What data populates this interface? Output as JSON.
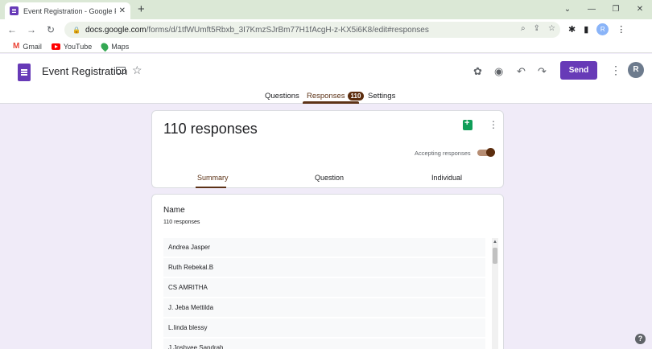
{
  "browser": {
    "tab_title": "Event Registration - Google Form",
    "tab_close": "✕",
    "new_tab": "+",
    "url_host": "docs.google.com",
    "url_path": "/forms/d/1tfWUmft5Rbxb_3I7KmzSJrBm77H1fAcgH-z-KX5i6K8/edit#responses",
    "profile_initial": "R",
    "bookmarks": [
      "Gmail",
      "YouTube",
      "Maps"
    ],
    "window_controls": [
      "⌄",
      "—",
      "❐",
      "✕"
    ]
  },
  "form": {
    "title": "Event Registration",
    "send_label": "Send",
    "avatar_initial": "R",
    "tabs": {
      "questions": "Questions",
      "responses": "Responses",
      "responses_count": "110",
      "settings": "Settings"
    }
  },
  "summary": {
    "heading": "110 responses",
    "accepting_label": "Accepting responses",
    "accepting": true,
    "subtabs": {
      "summary": "Summary",
      "question": "Question",
      "individual": "Individual"
    }
  },
  "question": {
    "title": "Name",
    "count_text": "110 responses",
    "responses": [
      "Andrea Jasper",
      "Ruth Rebekal.B",
      "CS AMRITHA",
      "J. Jeba Mettilda",
      "L.linda blessy",
      "J.Joshyee Sandrah"
    ]
  },
  "icons": {
    "theme": "palette-icon",
    "preview": "eye-icon",
    "undo": "undo-icon",
    "redo": "redo-icon",
    "help": "help-icon"
  },
  "colors": {
    "brand": "#673ab7",
    "accent": "#5c2d0e",
    "background": "#f0ebf8"
  }
}
